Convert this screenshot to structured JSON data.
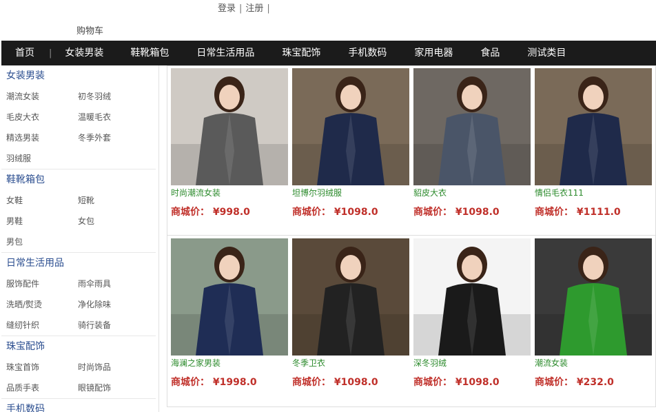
{
  "top": {
    "login": "登录",
    "sep": "|",
    "register": "注册",
    "sep2": "|"
  },
  "cart": "购物车",
  "nav": {
    "items": [
      "首页",
      "女装男装",
      "鞋靴箱包",
      "日常生活用品",
      "珠宝配饰",
      "手机数码",
      "家用电器",
      "食品",
      "测试类目"
    ],
    "divider": "|"
  },
  "sidebar": {
    "categories": [
      {
        "title": "女装男装",
        "subs": [
          "潮流女装",
          "初冬羽绒",
          "毛皮大衣",
          "温暖毛衣",
          "精选男装",
          "冬季外套",
          "羽绒服"
        ]
      },
      {
        "title": "鞋靴箱包",
        "subs": [
          "女鞋",
          "短靴",
          "男鞋",
          "女包",
          "男包"
        ]
      },
      {
        "title": "日常生活用品",
        "subs": [
          "服饰配件",
          "雨伞雨具",
          "洗晒/熨烫",
          "净化除味",
          "缝纫针织",
          "骑行装备"
        ]
      },
      {
        "title": "珠宝配饰",
        "subs": [
          "珠宝首饰",
          "时尚饰品",
          "品质手表",
          "眼镜配饰"
        ]
      },
      {
        "title": "手机数码",
        "subs": []
      }
    ]
  },
  "price_label": "商城价：",
  "products": [
    {
      "name": "时尚潮流女装",
      "price": "¥998.0",
      "icon": "knit-cardigan-photo",
      "bg": "#cfcac4",
      "fg": "#5a5a5a"
    },
    {
      "name": "坦博尔羽绒服",
      "price": "¥1098.0",
      "icon": "navy-coat-photo",
      "bg": "#7a6a58",
      "fg": "#1f2a4a"
    },
    {
      "name": "貂皮大衣",
      "price": "¥1098.0",
      "icon": "plaid-coat-photo",
      "bg": "#6e6862",
      "fg": "#4a5568"
    },
    {
      "name": "情侣毛衣111",
      "price": "¥1111.0",
      "icon": "navy-coat-photo",
      "bg": "#7a6a58",
      "fg": "#1f2a4a"
    },
    {
      "name": "海澜之家男装",
      "price": "¥1998.0",
      "icon": "navy-jacket-photo",
      "bg": "#8a9a8a",
      "fg": "#1f2d55"
    },
    {
      "name": "冬季卫衣",
      "price": "¥1098.0",
      "icon": "leather-jacket-scarf-photo",
      "bg": "#5a4a3a",
      "fg": "#222222"
    },
    {
      "name": "深冬羽绒",
      "price": "¥1098.0",
      "icon": "black-down-jacket-photo",
      "bg": "#f4f4f4",
      "fg": "#1a1a1a"
    },
    {
      "name": "潮流女装",
      "price": "¥232.0",
      "icon": "green-coat-photo",
      "bg": "#3a3a3a",
      "fg": "#2e9a2e"
    }
  ]
}
